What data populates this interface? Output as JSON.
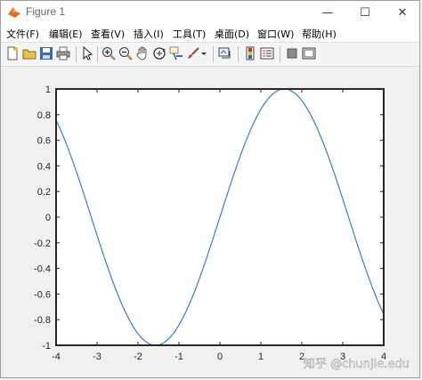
{
  "window": {
    "title": "Figure 1",
    "controls": {
      "minimize": "—",
      "maximize": "☐",
      "close": "✕"
    }
  },
  "menu": [
    "文件(F)",
    "编辑(E)",
    "查看(V)",
    "插入(I)",
    "工具(T)",
    "桌面(D)",
    "窗口(W)",
    "帮助(H)"
  ],
  "toolbar": [
    "new-figure",
    "open-file",
    "save",
    "print",
    "edit-plot",
    "zoom-in",
    "zoom-out",
    "pan",
    "rotate-3d",
    "data-cursor",
    "brush",
    "link-plot",
    "colorbar",
    "legend",
    "hide-plot-tools",
    "show-plot-tools"
  ],
  "chart_data": {
    "type": "line",
    "function": "sin(x)",
    "x_range": [
      -4,
      4
    ],
    "xlim": [
      -4,
      4
    ],
    "ylim": [
      -1,
      1
    ],
    "x_ticks": [
      "-4",
      "-3",
      "-2",
      "-1",
      "0",
      "1",
      "2",
      "3",
      "4"
    ],
    "y_ticks": [
      "1",
      "0.8",
      "0.6",
      "0.4",
      "0.2",
      "0",
      "-0.2",
      "-0.4",
      "-0.6",
      "-0.8",
      "-1"
    ],
    "line_color": "#3a7fbf",
    "grid": false,
    "points": [
      [
        -4.0,
        0.757
      ],
      [
        -3.5,
        0.351
      ],
      [
        -3.0,
        -0.141
      ],
      [
        -2.5,
        -0.598
      ],
      [
        -2.0,
        -0.909
      ],
      [
        -1.571,
        -1.0
      ],
      [
        -1.0,
        -0.841
      ],
      [
        -0.5,
        -0.479
      ],
      [
        0.0,
        0.0
      ],
      [
        0.5,
        0.479
      ],
      [
        1.0,
        0.841
      ],
      [
        1.571,
        1.0
      ],
      [
        2.0,
        0.909
      ],
      [
        2.5,
        0.598
      ],
      [
        3.0,
        0.141
      ],
      [
        3.5,
        -0.351
      ],
      [
        4.0,
        -0.757
      ]
    ]
  },
  "watermark": "知乎 @chunjie.edu"
}
